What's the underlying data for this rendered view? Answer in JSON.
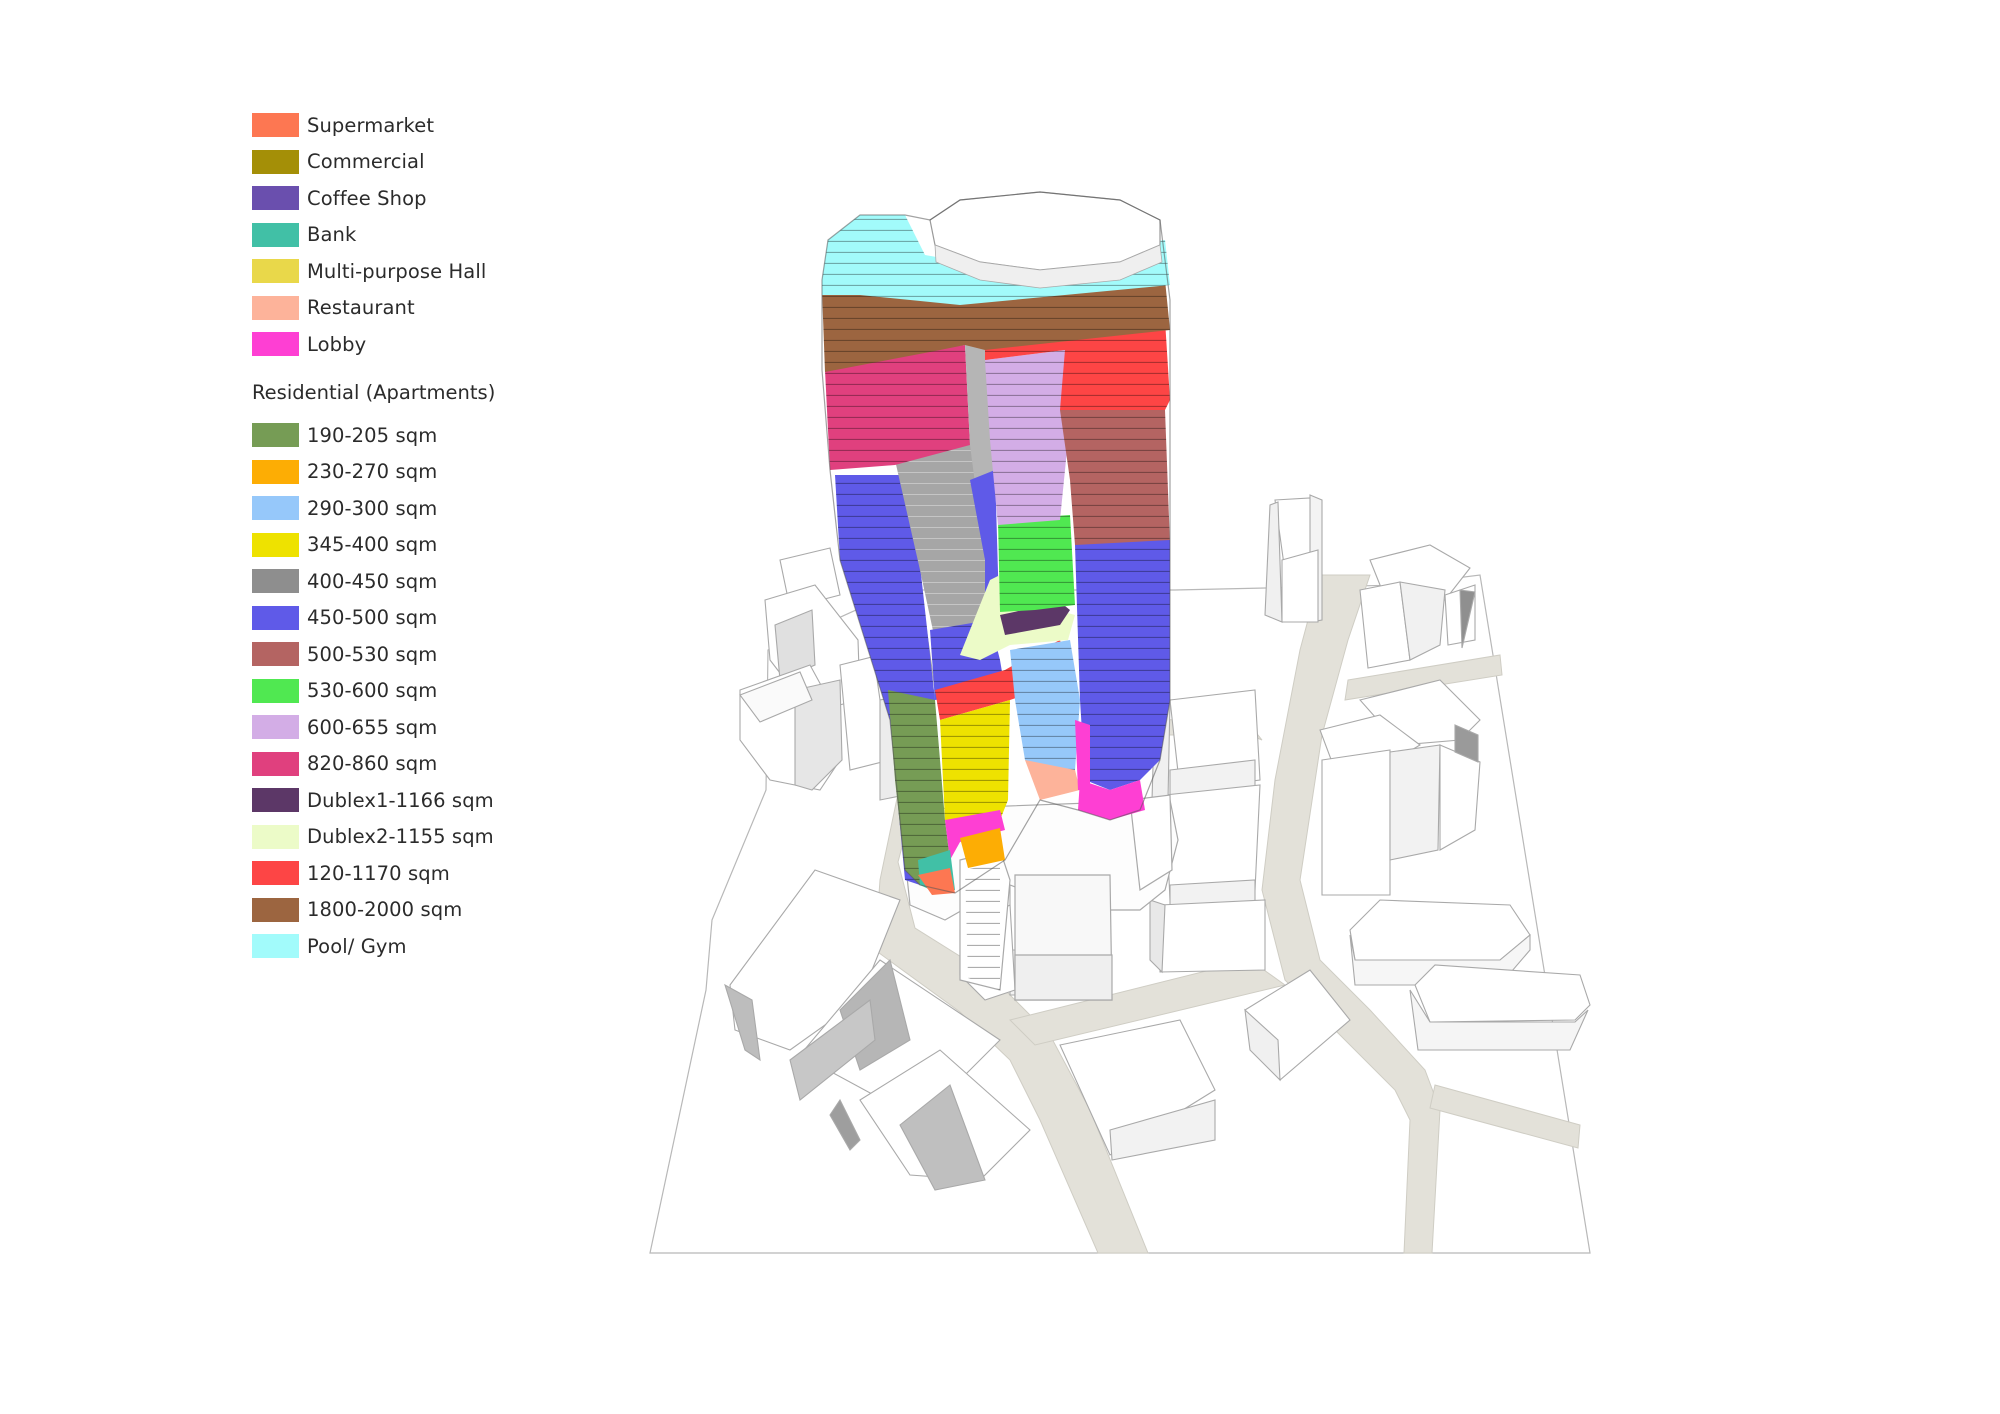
{
  "legend": {
    "uses": [
      {
        "label": "Supermarket",
        "color": "#fd7752"
      },
      {
        "label": "Commercial",
        "color": "#a48f07"
      },
      {
        "label": "Coffee Shop",
        "color": "#6a4fae"
      },
      {
        "label": "Bank",
        "color": "#41c0a6"
      },
      {
        "label": "Multi-purpose Hall",
        "color": "#e9d84a"
      },
      {
        "label": "Restaurant",
        "color": "#fdb39a"
      },
      {
        "label": "Lobby",
        "color": "#fe3fd3"
      }
    ],
    "residential_heading": "Residential (Apartments)",
    "residential": [
      {
        "label": "190-205 sqm",
        "color": "#769c55"
      },
      {
        "label": "230-270 sqm",
        "color": "#fdad04"
      },
      {
        "label": "290-300 sqm",
        "color": "#96c8fa"
      },
      {
        "label": "345-400 sqm",
        "color": "#eee200"
      },
      {
        "label": "400-450 sqm",
        "color": "#8e8e8e"
      },
      {
        "label": "450-500 sqm",
        "color": "#5f5ae8"
      },
      {
        "label": "500-530 sqm",
        "color": "#b46462"
      },
      {
        "label": "530-600 sqm",
        "color": "#50e851"
      },
      {
        "label": "600-655 sqm",
        "color": "#d3ade6"
      },
      {
        "label": "820-860 sqm",
        "color": "#e0407e"
      },
      {
        "label": "Dublex1-1166 sqm",
        "color": "#5c3767"
      },
      {
        "label": "Dublex2-1155 sqm",
        "color": "#ecfbc8"
      },
      {
        "label": "120-1170 sqm",
        "color": "#fd4545"
      },
      {
        "label": "1800-2000 sqm",
        "color": "#9c6540"
      },
      {
        "label": "Pool/ Gym",
        "color": "#a2fbfb"
      }
    ]
  }
}
